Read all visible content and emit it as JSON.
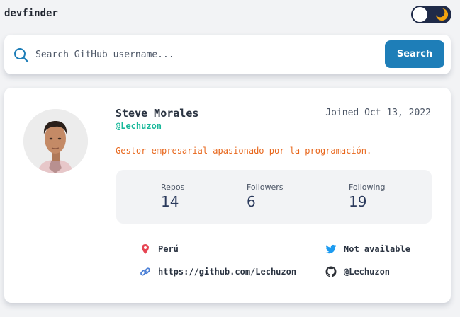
{
  "app": {
    "title": "devfinder"
  },
  "theme_toggle": {
    "icon": "moon-icon"
  },
  "search": {
    "placeholder": "Search GitHub username...",
    "value": "",
    "button_label": "Search"
  },
  "profile": {
    "name": "Steve Morales",
    "login": "@Lechuzon",
    "joined": "Joined Oct 13, 2022",
    "bio": "Gestor empresarial apasionado por la programación.",
    "stats": [
      {
        "label": "Repos",
        "value": "14"
      },
      {
        "label": "Followers",
        "value": "6"
      },
      {
        "label": "Following",
        "value": "19"
      }
    ],
    "links": {
      "location": {
        "icon": "location-pin-icon",
        "text": "Perú"
      },
      "blog": {
        "icon": "link-icon",
        "text": "https://github.com/Lechuzon"
      },
      "twitter": {
        "icon": "twitter-icon",
        "text": "Not available"
      },
      "github": {
        "icon": "github-icon",
        "text": "@Lechuzon"
      }
    }
  },
  "colors": {
    "accent": "#1e7eb8",
    "login": "#19b89a",
    "bio": "#e8671c",
    "toggle_bg": "#1f2a48",
    "moon": "#f2a30f"
  }
}
